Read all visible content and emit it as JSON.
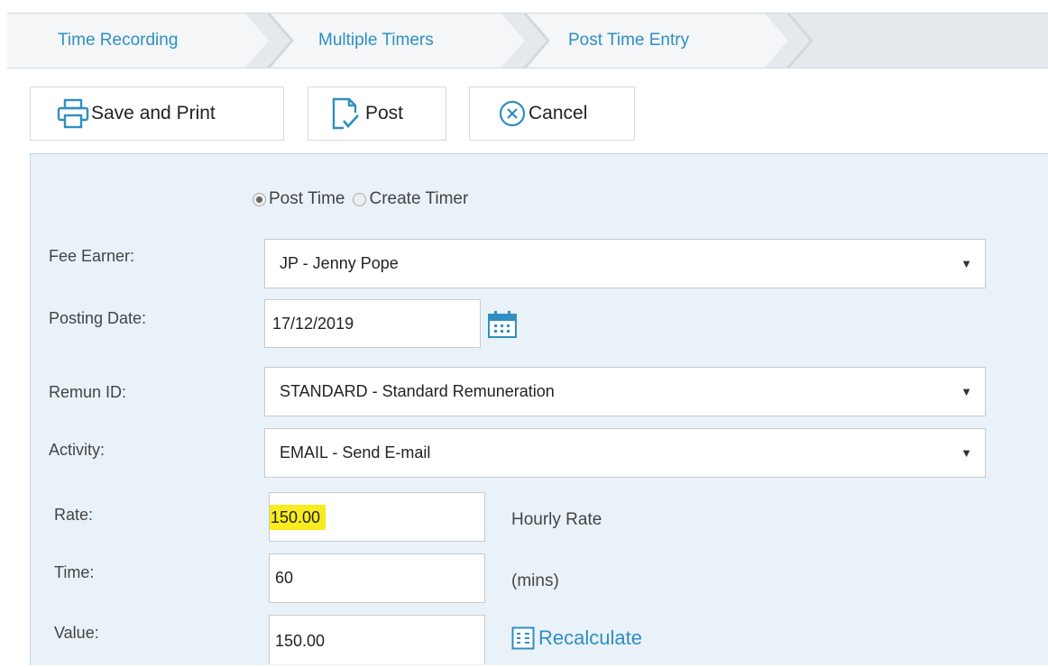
{
  "breadcrumb": {
    "items": [
      "Time Recording",
      "Multiple Timers",
      "Post Time Entry"
    ]
  },
  "toolbar": {
    "save_print": "Save and Print",
    "post": "Post",
    "cancel": "Cancel"
  },
  "mode": {
    "post_time": "Post Time",
    "create_timer": "Create Timer",
    "selected": "Post Time"
  },
  "form": {
    "fee_earner_label": "Fee Earner:",
    "fee_earner_value": "JP - Jenny Pope",
    "posting_date_label": "Posting Date:",
    "posting_date_value": "17/12/2019",
    "remun_label": "Remun ID:",
    "remun_value": "STANDARD - Standard Remuneration",
    "activity_label": "Activity:",
    "activity_value": "EMAIL - Send E-mail",
    "rate_label": "Rate:",
    "rate_value": "150.00",
    "rate_note": "Hourly Rate",
    "time_label": "Time:",
    "time_value": "60",
    "time_note": "(mins)",
    "value_label": "Value:",
    "value_value": "150.00",
    "recalculate": "Recalculate"
  },
  "colors": {
    "accent": "#2f8fc1",
    "panel": "#e9f2f9",
    "highlight": "#f8ec1e"
  }
}
